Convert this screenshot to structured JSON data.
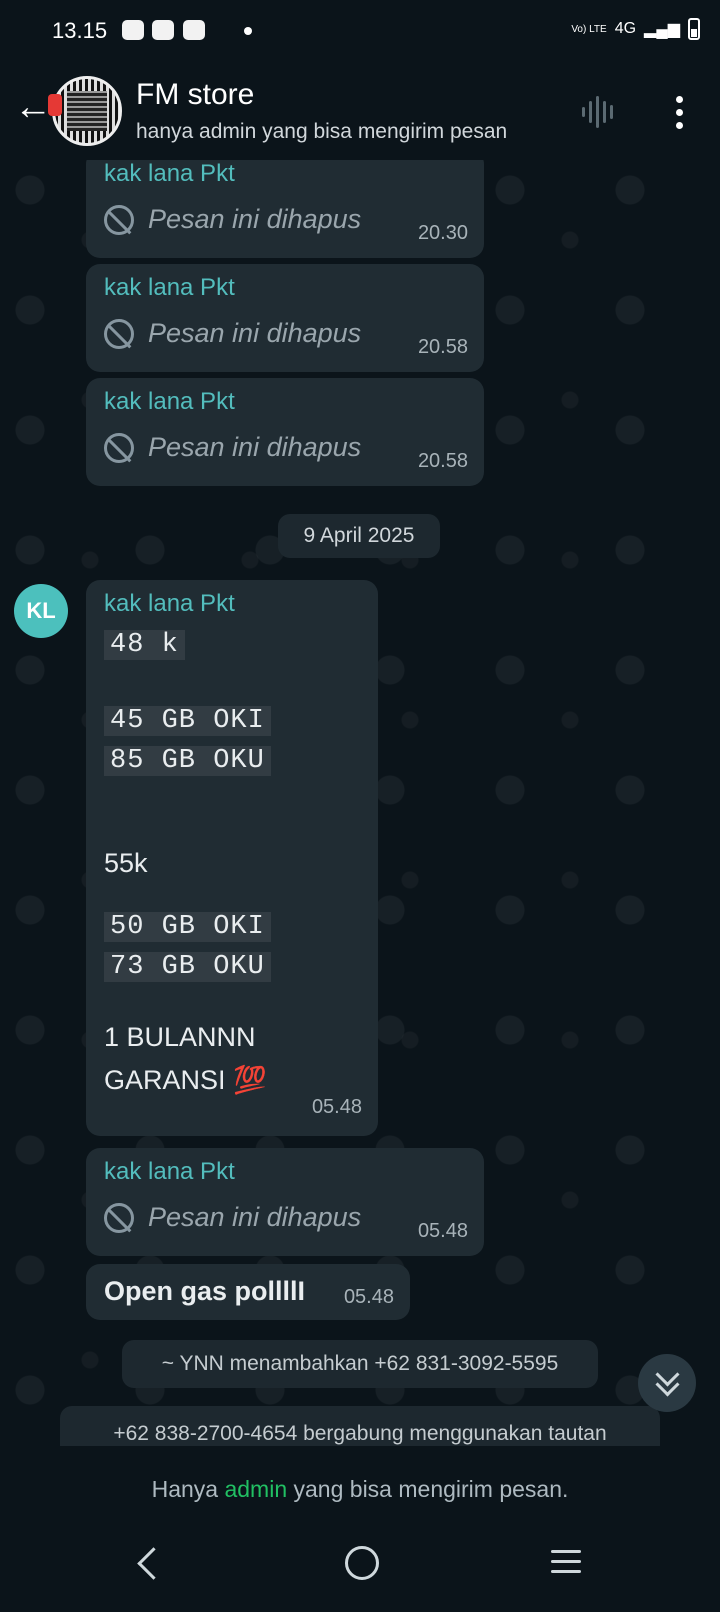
{
  "status_bar": {
    "time": "13.15",
    "network": "4G",
    "volte": "Vo) LTE"
  },
  "header": {
    "title": "FM store",
    "subtitle": "hanya admin yang bisa mengirim pesan"
  },
  "messages": [
    {
      "sender": "kak lana Pkt",
      "text": "Pesan ini dihapus",
      "time": "20.30"
    },
    {
      "sender": "kak lana Pkt",
      "text": "Pesan ini dihapus",
      "time": "20.58"
    },
    {
      "sender": "kak lana Pkt",
      "text": "Pesan ini dihapus",
      "time": "20.58"
    }
  ],
  "date_separator": "9 April 2025",
  "price_message": {
    "avatar_initials": "KL",
    "sender": "kak lana Pkt",
    "line1": "48 k",
    "line2": "45 GB OKI",
    "line3": "85 GB OKU",
    "line4": "55k",
    "line5": "50 GB OKI",
    "line6": "73 GB OKU",
    "line7": "1 BULANNN",
    "line8": "GARANSI 💯",
    "time": "05.48"
  },
  "deleted_message_4": {
    "sender": "kak lana Pkt",
    "text": "Pesan ini dihapus",
    "time": "05.48"
  },
  "open_message": {
    "text": "Open gas pollllI",
    "time": "05.48"
  },
  "system_messages": [
    "~ YNN menambahkan +62 831-3092-5595",
    "+62 838-2700-4654 bergabung menggunakan tautan"
  ],
  "footer": {
    "prefix": "Hanya ",
    "highlight": "admin",
    "suffix": " yang bisa mengirim pesan."
  },
  "colors": {
    "accent_green": "#21c063",
    "sender_teal": "#53bdbd",
    "bubble": "#202c33"
  }
}
